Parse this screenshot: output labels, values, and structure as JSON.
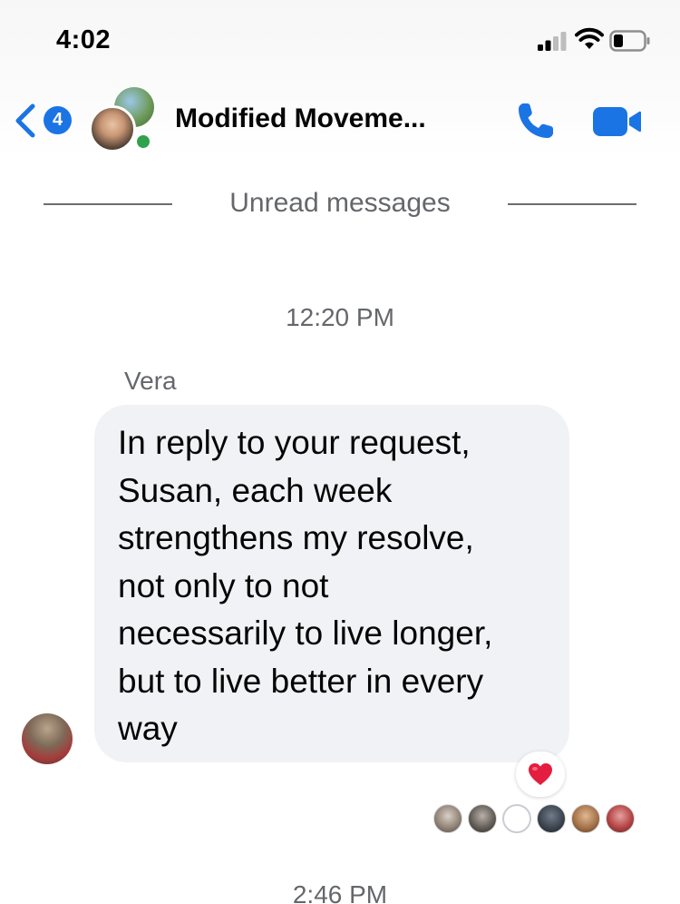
{
  "status_bar": {
    "time": "4:02"
  },
  "header": {
    "back_badge_count": "4",
    "title": "Modified Moveme...",
    "icons": {
      "back": "chevron-left-icon",
      "call": "phone-icon",
      "video": "video-camera-icon"
    }
  },
  "conversation": {
    "unread_divider": "Unread messages",
    "timestamps": [
      "12:20 PM",
      "2:46 PM"
    ],
    "message": {
      "sender": "Vera",
      "lines": [
        "In reply to your request,",
        "Susan, each week",
        "strengthens my resolve,",
        "not only to not",
        "necessarily to live longer,",
        "but to live better in every",
        "way"
      ],
      "reaction": "❤️"
    },
    "read_receipt_count": 6
  },
  "colors": {
    "accent": "#1b74e4",
    "online": "#31a24c",
    "bubble": "#f0f2f5",
    "secondary_text": "#65676b",
    "reaction_heart": "#e41e3f"
  }
}
